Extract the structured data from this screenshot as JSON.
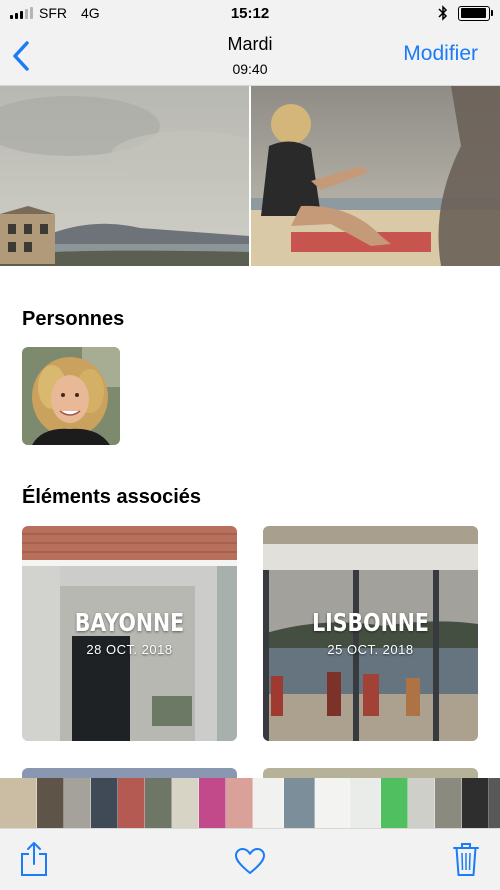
{
  "status_bar": {
    "carrier": "SFR",
    "network": "4G",
    "time": "15:12",
    "bluetooth_icon": "bluetooth-icon",
    "battery_level": 0.95
  },
  "nav": {
    "back_icon": "chevron-left-icon",
    "title": "Mardi",
    "subtitle": "09:40",
    "edit_label": "Modifier",
    "accent_color": "#1a7cf7"
  },
  "people": {
    "heading": "Personnes"
  },
  "related": {
    "heading": "Éléments associés",
    "memories": [
      {
        "title": "BAYONNE",
        "date": "28 OCT. 2018"
      },
      {
        "title": "LISBONNE",
        "date": "25 OCT. 2018"
      }
    ]
  },
  "toolbar": {
    "share_icon": "share-icon",
    "favorite_icon": "heart-icon",
    "delete_icon": "trash-icon"
  }
}
